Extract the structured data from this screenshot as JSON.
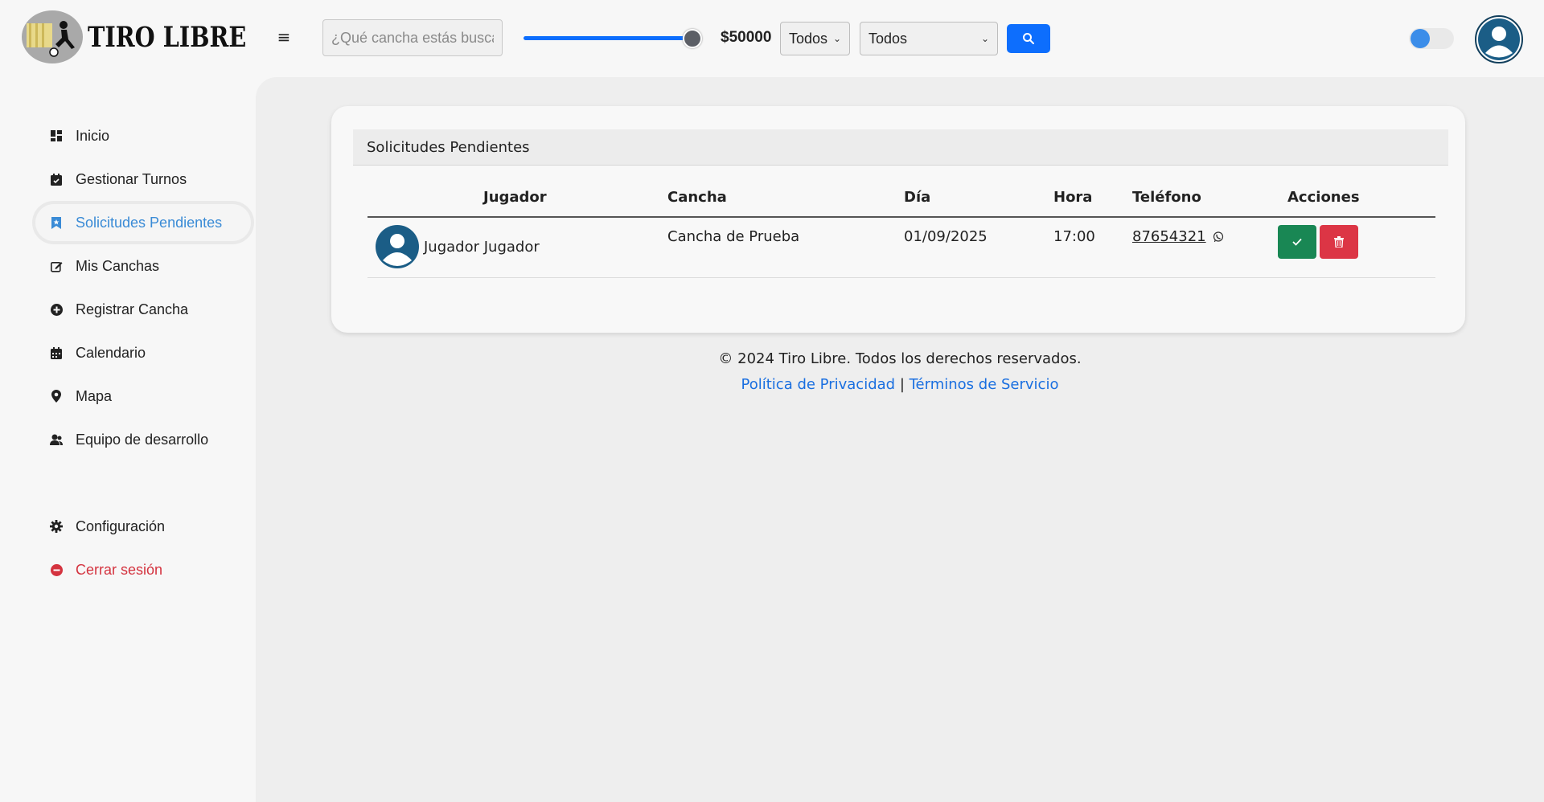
{
  "brand": {
    "name": "TIRO LIBRE"
  },
  "search": {
    "placeholder": "¿Qué cancha estás buscando?",
    "value": ""
  },
  "price_filter": {
    "label": "$50000",
    "slider_level": 1.0
  },
  "filters": {
    "select1": "Todos",
    "select2": "Todos"
  },
  "theme_toggle": {
    "on": false
  },
  "sidebar": {
    "items": [
      {
        "label": "Inicio",
        "icon": "dashboard-icon"
      },
      {
        "label": "Gestionar Turnos",
        "icon": "calendar-check-icon"
      },
      {
        "label": "Solicitudes Pendientes",
        "icon": "bookmark-icon",
        "active": true
      },
      {
        "label": "Mis Canchas",
        "icon": "edit-icon"
      },
      {
        "label": "Registrar Cancha",
        "icon": "plus-circle-icon"
      },
      {
        "label": "Calendario",
        "icon": "calendar-icon"
      },
      {
        "label": "Mapa",
        "icon": "map-pin-icon"
      },
      {
        "label": "Equipo de desarrollo",
        "icon": "users-icon"
      },
      {
        "label": "Configuración",
        "icon": "gear-icon"
      },
      {
        "label": "Cerrar sesión",
        "icon": "logout-icon"
      }
    ]
  },
  "card": {
    "title": "Solicitudes Pendientes",
    "columns": [
      "Jugador",
      "Cancha",
      "Día",
      "Hora",
      "Teléfono",
      "Acciones"
    ],
    "rows": [
      {
        "player": "Jugador Jugador",
        "court": "Cancha de Prueba",
        "day": "01/09/2025",
        "hour": "17:00",
        "phone": "87654321"
      }
    ]
  },
  "footer": {
    "copyright": "© 2024 Tiro Libre. Todos los derechos reservados.",
    "privacy": "Política de Privacidad",
    "separator": "|",
    "terms": "Términos de Servicio"
  },
  "colors": {
    "accent": "#0d6efd",
    "active_nav": "#3a8bd6",
    "logout": "#d4333f",
    "accept": "#198754",
    "delete": "#dc3545",
    "avatar": "#1b5d86"
  }
}
